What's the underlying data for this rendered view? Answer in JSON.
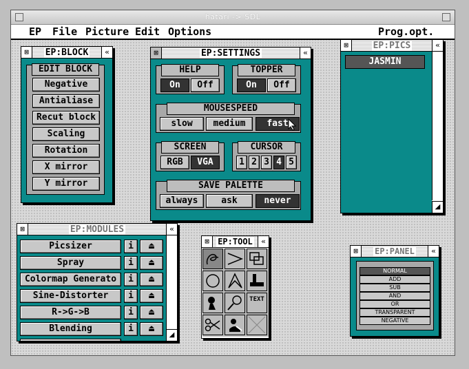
{
  "window_title": "hatari -> SDL",
  "menu": {
    "ep": "EP",
    "file": "File",
    "picture": "Picture",
    "edit": "Edit",
    "options": "Options",
    "right": "Prog.opt.(☒O)"
  },
  "block": {
    "title": "EP:BLOCK",
    "header": "EDIT BLOCK",
    "items": [
      "Negative",
      "Antialiase",
      "Recut block",
      "Scaling",
      "Rotation",
      "X mirror",
      "Y mirror"
    ]
  },
  "settings": {
    "title": "EP:SETTINGS",
    "help": {
      "label": "HELP",
      "on": "On",
      "off": "Off"
    },
    "topper": {
      "label": "TOPPER",
      "on": "On",
      "off": "Off"
    },
    "mousespeed": {
      "label": "MOUSESPEED",
      "slow": "slow",
      "medium": "medium",
      "fast": "fast"
    },
    "screen": {
      "label": "SCREEN",
      "rgb": "RGB",
      "vga": "VGA"
    },
    "cursor": {
      "label": "CURSOR",
      "values": [
        "1",
        "2",
        "3",
        "4",
        "5"
      ]
    },
    "palette": {
      "label": "SAVE PALETTE",
      "always": "always",
      "ask": "ask",
      "never": "never"
    }
  },
  "pics": {
    "title": "EP:PICS",
    "items": [
      "JASMIN"
    ]
  },
  "modules": {
    "title": "EP:MODULES",
    "items": [
      "Picsizer",
      "Spray",
      "Colormap Generato",
      "Sine-Distorter",
      "R->G->B",
      "Blending"
    ],
    "info_label": "i"
  },
  "tool": {
    "title": "EP:TOOL",
    "text_tool": "TEXT"
  },
  "panel": {
    "title": "EP:PANEL",
    "items": [
      "NORMAL",
      "ADD",
      "SUB",
      "AND",
      "OR",
      "TRANSPARENT",
      "NEGATIVE"
    ]
  },
  "colors": {
    "teal": "#0a8a8a",
    "selected": "#333333"
  }
}
